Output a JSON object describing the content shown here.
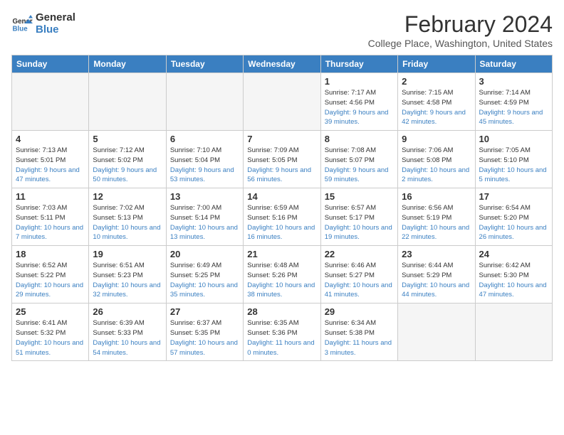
{
  "logo": {
    "line1": "General",
    "line2": "Blue"
  },
  "title": "February 2024",
  "location": "College Place, Washington, United States",
  "days_of_week": [
    "Sunday",
    "Monday",
    "Tuesday",
    "Wednesday",
    "Thursday",
    "Friday",
    "Saturday"
  ],
  "weeks": [
    [
      {
        "day": "",
        "empty": true
      },
      {
        "day": "",
        "empty": true
      },
      {
        "day": "",
        "empty": true
      },
      {
        "day": "",
        "empty": true
      },
      {
        "day": "1",
        "sunrise": "7:17 AM",
        "sunset": "4:56 PM",
        "daylight": "9 hours and 39 minutes."
      },
      {
        "day": "2",
        "sunrise": "7:15 AM",
        "sunset": "4:58 PM",
        "daylight": "9 hours and 42 minutes."
      },
      {
        "day": "3",
        "sunrise": "7:14 AM",
        "sunset": "4:59 PM",
        "daylight": "9 hours and 45 minutes."
      }
    ],
    [
      {
        "day": "4",
        "sunrise": "7:13 AM",
        "sunset": "5:01 PM",
        "daylight": "9 hours and 47 minutes."
      },
      {
        "day": "5",
        "sunrise": "7:12 AM",
        "sunset": "5:02 PM",
        "daylight": "9 hours and 50 minutes."
      },
      {
        "day": "6",
        "sunrise": "7:10 AM",
        "sunset": "5:04 PM",
        "daylight": "9 hours and 53 minutes."
      },
      {
        "day": "7",
        "sunrise": "7:09 AM",
        "sunset": "5:05 PM",
        "daylight": "9 hours and 56 minutes."
      },
      {
        "day": "8",
        "sunrise": "7:08 AM",
        "sunset": "5:07 PM",
        "daylight": "9 hours and 59 minutes."
      },
      {
        "day": "9",
        "sunrise": "7:06 AM",
        "sunset": "5:08 PM",
        "daylight": "10 hours and 2 minutes."
      },
      {
        "day": "10",
        "sunrise": "7:05 AM",
        "sunset": "5:10 PM",
        "daylight": "10 hours and 5 minutes."
      }
    ],
    [
      {
        "day": "11",
        "sunrise": "7:03 AM",
        "sunset": "5:11 PM",
        "daylight": "10 hours and 7 minutes."
      },
      {
        "day": "12",
        "sunrise": "7:02 AM",
        "sunset": "5:13 PM",
        "daylight": "10 hours and 10 minutes."
      },
      {
        "day": "13",
        "sunrise": "7:00 AM",
        "sunset": "5:14 PM",
        "daylight": "10 hours and 13 minutes."
      },
      {
        "day": "14",
        "sunrise": "6:59 AM",
        "sunset": "5:16 PM",
        "daylight": "10 hours and 16 minutes."
      },
      {
        "day": "15",
        "sunrise": "6:57 AM",
        "sunset": "5:17 PM",
        "daylight": "10 hours and 19 minutes."
      },
      {
        "day": "16",
        "sunrise": "6:56 AM",
        "sunset": "5:19 PM",
        "daylight": "10 hours and 22 minutes."
      },
      {
        "day": "17",
        "sunrise": "6:54 AM",
        "sunset": "5:20 PM",
        "daylight": "10 hours and 26 minutes."
      }
    ],
    [
      {
        "day": "18",
        "sunrise": "6:52 AM",
        "sunset": "5:22 PM",
        "daylight": "10 hours and 29 minutes."
      },
      {
        "day": "19",
        "sunrise": "6:51 AM",
        "sunset": "5:23 PM",
        "daylight": "10 hours and 32 minutes."
      },
      {
        "day": "20",
        "sunrise": "6:49 AM",
        "sunset": "5:25 PM",
        "daylight": "10 hours and 35 minutes."
      },
      {
        "day": "21",
        "sunrise": "6:48 AM",
        "sunset": "5:26 PM",
        "daylight": "10 hours and 38 minutes."
      },
      {
        "day": "22",
        "sunrise": "6:46 AM",
        "sunset": "5:27 PM",
        "daylight": "10 hours and 41 minutes."
      },
      {
        "day": "23",
        "sunrise": "6:44 AM",
        "sunset": "5:29 PM",
        "daylight": "10 hours and 44 minutes."
      },
      {
        "day": "24",
        "sunrise": "6:42 AM",
        "sunset": "5:30 PM",
        "daylight": "10 hours and 47 minutes."
      }
    ],
    [
      {
        "day": "25",
        "sunrise": "6:41 AM",
        "sunset": "5:32 PM",
        "daylight": "10 hours and 51 minutes."
      },
      {
        "day": "26",
        "sunrise": "6:39 AM",
        "sunset": "5:33 PM",
        "daylight": "10 hours and 54 minutes."
      },
      {
        "day": "27",
        "sunrise": "6:37 AM",
        "sunset": "5:35 PM",
        "daylight": "10 hours and 57 minutes."
      },
      {
        "day": "28",
        "sunrise": "6:35 AM",
        "sunset": "5:36 PM",
        "daylight": "11 hours and 0 minutes."
      },
      {
        "day": "29",
        "sunrise": "6:34 AM",
        "sunset": "5:38 PM",
        "daylight": "11 hours and 3 minutes."
      },
      {
        "day": "",
        "empty": true
      },
      {
        "day": "",
        "empty": true
      }
    ]
  ],
  "labels": {
    "sunrise": "Sunrise:",
    "sunset": "Sunset:",
    "daylight": "Daylight:"
  }
}
